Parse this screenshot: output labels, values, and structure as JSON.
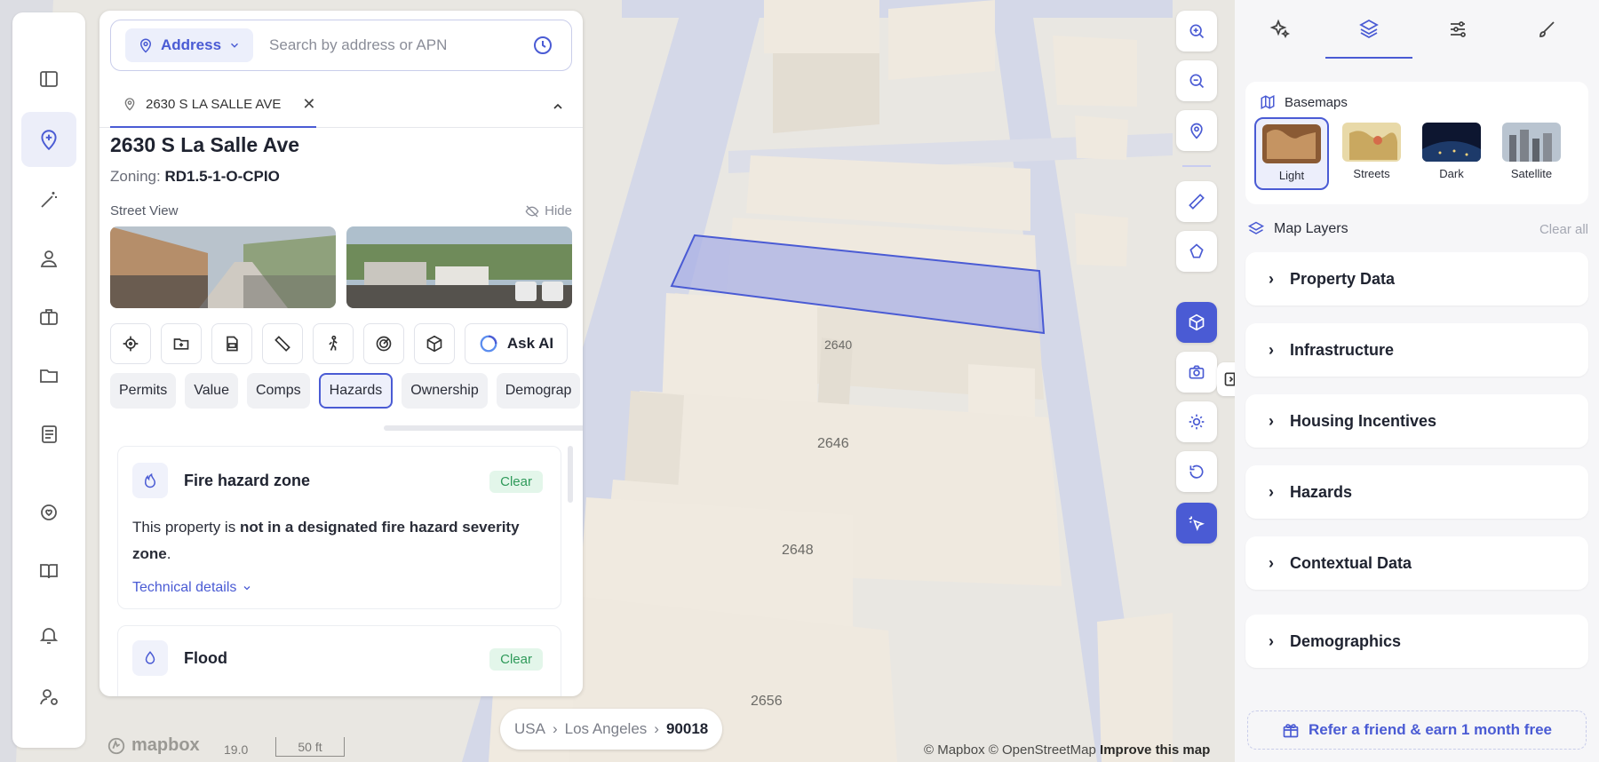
{
  "rail": {
    "items": [
      "sidebar-toggle",
      "map-pin",
      "magic-wand",
      "person-pin",
      "briefcase",
      "folder",
      "newspaper",
      "chat",
      "book",
      "bell",
      "user-settings"
    ]
  },
  "search": {
    "mode_label": "Address",
    "placeholder": "Search by address or APN"
  },
  "tab": {
    "label": "2630 S LA SALLE AVE"
  },
  "property": {
    "title": "2630 S La Salle Ave",
    "zoning_label": "Zoning:",
    "zoning_value": "RD1.5-1-O-CPIO",
    "street_view_label": "Street View",
    "hide_label": "Hide"
  },
  "tools": {
    "ask_ai": "Ask AI"
  },
  "chips": [
    {
      "label": "Permits",
      "active": false
    },
    {
      "label": "Value",
      "active": false
    },
    {
      "label": "Comps",
      "active": false
    },
    {
      "label": "Hazards",
      "active": true
    },
    {
      "label": "Ownership",
      "active": false
    },
    {
      "label": "Demograp",
      "active": false
    }
  ],
  "hazards": {
    "fire": {
      "title": "Fire hazard zone",
      "badge": "Clear",
      "text_pre": "This property is ",
      "text_bold": "not in a designated fire hazard severity zone",
      "text_post": ".",
      "details": "Technical details"
    },
    "flood": {
      "title": "Flood",
      "badge": "Clear"
    }
  },
  "map": {
    "labels": [
      "2640",
      "2646",
      "2648",
      "2656"
    ],
    "breadcrumb": [
      "USA",
      "Los Angeles",
      "90018"
    ],
    "zoom": "19.0",
    "scale": "50 ft",
    "logo": "mapbox",
    "attribution": "© Mapbox © OpenStreetMap",
    "improve": "Improve this map",
    "colors": {
      "selection": "#4a5bd4",
      "button": "#4a5bd4"
    }
  },
  "right": {
    "basemaps_title": "Basemaps",
    "basemaps": [
      {
        "label": "Light",
        "active": true
      },
      {
        "label": "Streets",
        "active": false
      },
      {
        "label": "Dark",
        "active": false
      },
      {
        "label": "Satellite",
        "active": false
      }
    ],
    "map_layers_title": "Map Layers",
    "clear_all": "Clear all",
    "layers": [
      "Property Data",
      "Infrastructure",
      "Housing Incentives",
      "Hazards",
      "Contextual Data",
      "Demographics"
    ],
    "refer": "Refer a friend & earn 1 month free"
  }
}
